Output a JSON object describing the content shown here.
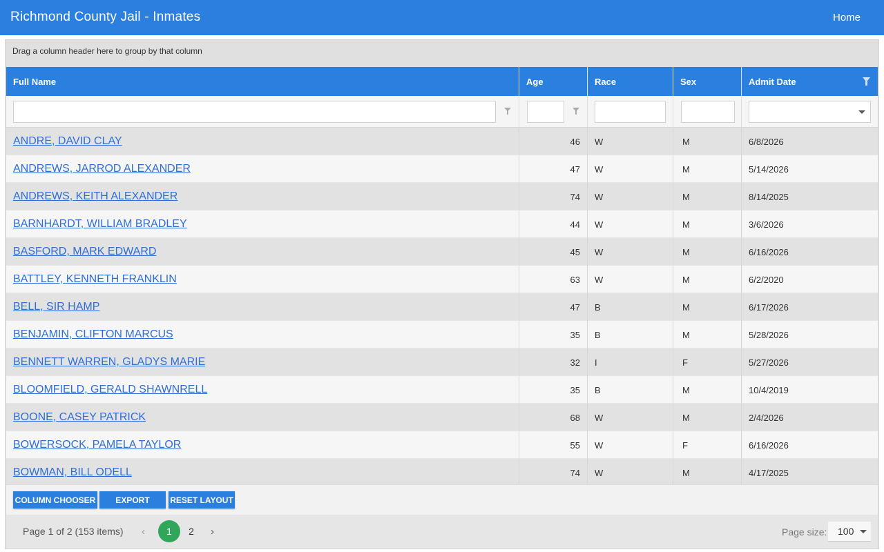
{
  "header": {
    "title": "Richmond County Jail - Inmates",
    "home_label": "Home"
  },
  "grid": {
    "group_panel_text": "Drag a column header here to group by that column",
    "columns": [
      "Full Name",
      "Age",
      "Race",
      "Sex",
      "Admit Date"
    ],
    "rows": [
      {
        "name": "ANDRE, DAVID CLAY",
        "age": "46",
        "race": "W",
        "sex": "M",
        "admit": "6/8/2026"
      },
      {
        "name": "ANDREWS, JARROD ALEXANDER",
        "age": "47",
        "race": "W",
        "sex": "M",
        "admit": "5/14/2026"
      },
      {
        "name": "ANDREWS, KEITH ALEXANDER",
        "age": "74",
        "race": "W",
        "sex": "M",
        "admit": "8/14/2025"
      },
      {
        "name": "BARNHARDT, WILLIAM BRADLEY",
        "age": "44",
        "race": "W",
        "sex": "M",
        "admit": "3/6/2026"
      },
      {
        "name": "BASFORD, MARK EDWARD",
        "age": "45",
        "race": "W",
        "sex": "M",
        "admit": "6/16/2026"
      },
      {
        "name": "BATTLEY, KENNETH FRANKLIN",
        "age": "63",
        "race": "W",
        "sex": "M",
        "admit": "6/2/2020"
      },
      {
        "name": "BELL, SIR HAMP",
        "age": "47",
        "race": "B",
        "sex": "M",
        "admit": "6/17/2026"
      },
      {
        "name": "BENJAMIN, CLIFTON MARCUS",
        "age": "35",
        "race": "B",
        "sex": "M",
        "admit": "5/28/2026"
      },
      {
        "name": "BENNETT WARREN, GLADYS MARIE",
        "age": "32",
        "race": "I",
        "sex": "F",
        "admit": "5/27/2026"
      },
      {
        "name": "BLOOMFIELD, GERALD SHAWNRELL",
        "age": "35",
        "race": "B",
        "sex": "M",
        "admit": "10/4/2019"
      },
      {
        "name": "BOONE, CASEY PATRICK",
        "age": "68",
        "race": "W",
        "sex": "M",
        "admit": "2/4/2026"
      },
      {
        "name": "BOWERSOCK, PAMELA TAYLOR",
        "age": "55",
        "race": "W",
        "sex": "F",
        "admit": "6/16/2026"
      },
      {
        "name": "BOWMAN, BILL ODELL",
        "age": "74",
        "race": "W",
        "sex": "M",
        "admit": "4/17/2025"
      }
    ]
  },
  "toolbar": {
    "column_chooser": "COLUMN CHOOSER",
    "export": "EXPORT",
    "reset_layout": "RESET LAYOUT"
  },
  "pager": {
    "info": "Page 1 of 2 (153 items)",
    "pages": [
      "1",
      "2"
    ],
    "prev_glyph": "‹",
    "next_glyph": "›",
    "page_size_label": "Page size:",
    "page_size_value": "100"
  },
  "colors": {
    "accent": "#2a7fdf",
    "link": "#2d6fd6",
    "active_page": "#2fa65a"
  },
  "icons": [
    "filter-icon",
    "chevron-down-icon",
    "chevron-left-icon",
    "chevron-right-icon"
  ]
}
